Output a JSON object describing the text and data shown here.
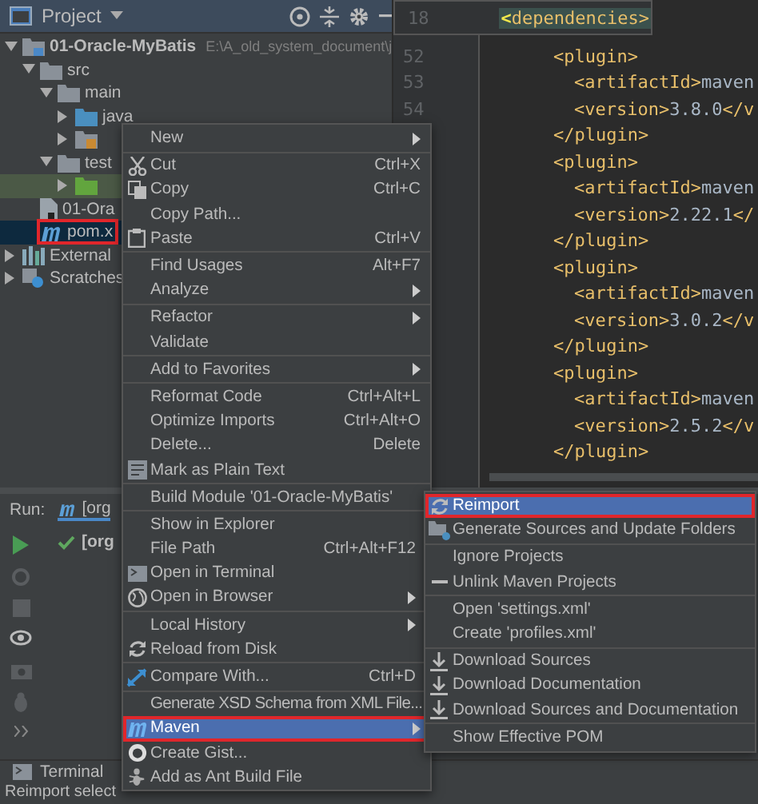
{
  "project_panel": {
    "title": "Project",
    "tree": [
      {
        "label": "01-Oracle-MyBatis",
        "path": "E:\\A_old_system_document\\j",
        "kind": "module",
        "expanded": true,
        "selected": false,
        "highlighted": false,
        "marked": false,
        "children": [
          {
            "label": "src",
            "kind": "folder",
            "expanded": true,
            "selected": false,
            "highlighted": false,
            "marked": false,
            "children": [
              {
                "label": "main",
                "kind": "folder",
                "expanded": true,
                "selected": false,
                "highlighted": false,
                "marked": false,
                "children": [
                  {
                    "label": "java",
                    "kind": "source_folder",
                    "expanded": false,
                    "selected": false,
                    "highlighted": false,
                    "marked": false
                  },
                  {
                    "kind": "resource_folder",
                    "expanded": false,
                    "selected": false,
                    "highlighted": false,
                    "marked": false
                  }
                ]
              },
              {
                "label": "test",
                "kind": "folder",
                "expanded": true,
                "selected": false,
                "highlighted": false,
                "marked": false,
                "children": [
                  {
                    "kind": "test_folder",
                    "expanded": false,
                    "selected": false,
                    "highlighted": true,
                    "marked": false
                  }
                ]
              }
            ]
          },
          {
            "label": "01-Ora",
            "kind": "module_file",
            "selected": false,
            "highlighted": false,
            "marked": false
          },
          {
            "label": "pom.x",
            "kind": "pom",
            "selected": true,
            "highlighted": false,
            "marked": true
          }
        ]
      },
      {
        "label": "External",
        "kind": "libraries",
        "expanded": false,
        "selected": false,
        "highlighted": false,
        "marked": false
      },
      {
        "label": "Scratches",
        "kind": "scratches",
        "expanded": false,
        "selected": false,
        "highlighted": false,
        "marked": false
      }
    ]
  },
  "editor": {
    "sticky_header": {
      "line": "18",
      "open": "<",
      "text": "dependencies>"
    },
    "lines": [
      {
        "number": "52",
        "kind": "outer",
        "open": "<plugin>"
      },
      {
        "number": "53",
        "kind": "inner",
        "open": "<artifactId>",
        "text": "maven"
      },
      {
        "number": "54",
        "kind": "inner",
        "open": "<version>",
        "text": "3.8.0",
        "close": "</v"
      },
      {
        "kind": "outer",
        "open": "</plugin>"
      },
      {
        "kind": "outer",
        "open": "<plugin>"
      },
      {
        "kind": "inner",
        "open": "<artifactId>",
        "text": "maven"
      },
      {
        "kind": "inner",
        "open": "<version>",
        "text": "2.22.1",
        "close": "</"
      },
      {
        "kind": "outer",
        "open": "</plugin>"
      },
      {
        "kind": "outer",
        "open": "<plugin>"
      },
      {
        "kind": "inner",
        "open": "<artifactId>",
        "text": "maven"
      },
      {
        "kind": "inner",
        "open": "<version>",
        "text": "3.0.2",
        "close": "</v"
      },
      {
        "kind": "outer",
        "open": "</plugin>"
      },
      {
        "kind": "outer",
        "open": "<plugin>"
      },
      {
        "kind": "inner",
        "open": "<artifactId>",
        "text": "maven"
      },
      {
        "kind": "inner",
        "open": "<version>",
        "text": "2.5.2",
        "close": "</v"
      },
      {
        "kind": "outer",
        "open": "</plugin>"
      }
    ]
  },
  "run_panel": {
    "label": "Run:",
    "tab": "[org",
    "tree": [
      {
        "label": "[org",
        "passed": true
      }
    ]
  },
  "status_bar": {
    "tool_tab": "Terminal",
    "message": "Reimport select"
  },
  "context_menu": [
    {
      "kind": "item",
      "label": "New",
      "submenu": true,
      "selected": false,
      "marked": false
    },
    {
      "kind": "separator"
    },
    {
      "kind": "item",
      "label": "Cut",
      "shortcut": "Ctrl+X",
      "submenu": false,
      "selected": false,
      "marked": false
    },
    {
      "kind": "item",
      "label": "Copy",
      "shortcut": "Ctrl+C",
      "submenu": false,
      "selected": false,
      "marked": false
    },
    {
      "kind": "item",
      "label": "Copy Path...",
      "submenu": false,
      "selected": false,
      "marked": false
    },
    {
      "kind": "item",
      "label": "Paste",
      "shortcut": "Ctrl+V",
      "submenu": false,
      "selected": false,
      "marked": false
    },
    {
      "kind": "separator"
    },
    {
      "kind": "item",
      "label": "Find Usages",
      "shortcut": "Alt+F7",
      "submenu": false,
      "selected": false,
      "marked": false
    },
    {
      "kind": "item",
      "label": "Analyze",
      "submenu": true,
      "selected": false,
      "marked": false
    },
    {
      "kind": "separator"
    },
    {
      "kind": "item",
      "label": "Refactor",
      "submenu": true,
      "selected": false,
      "marked": false
    },
    {
      "kind": "item",
      "label": "Validate",
      "submenu": false,
      "selected": false,
      "marked": false
    },
    {
      "kind": "separator"
    },
    {
      "kind": "item",
      "label": "Add to Favorites",
      "submenu": true,
      "selected": false,
      "marked": false
    },
    {
      "kind": "separator"
    },
    {
      "kind": "item",
      "label": "Reformat Code",
      "shortcut": "Ctrl+Alt+L",
      "submenu": false,
      "selected": false,
      "marked": false
    },
    {
      "kind": "item",
      "label": "Optimize Imports",
      "shortcut": "Ctrl+Alt+O",
      "submenu": false,
      "selected": false,
      "marked": false
    },
    {
      "kind": "item",
      "label": "Delete...",
      "shortcut": "Delete",
      "submenu": false,
      "selected": false,
      "marked": false
    },
    {
      "kind": "item",
      "label": "Mark as Plain Text",
      "submenu": false,
      "selected": false,
      "marked": false
    },
    {
      "kind": "separator"
    },
    {
      "kind": "item",
      "label": "Build Module '01-Oracle-MyBatis'",
      "submenu": false,
      "selected": false,
      "marked": false
    },
    {
      "kind": "separator"
    },
    {
      "kind": "item",
      "label": "Show in Explorer",
      "submenu": false,
      "selected": false,
      "marked": false
    },
    {
      "kind": "item",
      "label": "File Path",
      "shortcut": "Ctrl+Alt+F12",
      "submenu": false,
      "selected": false,
      "marked": false
    },
    {
      "kind": "item",
      "label": "Open in Terminal",
      "submenu": false,
      "selected": false,
      "marked": false
    },
    {
      "kind": "item",
      "label": "Open in Browser",
      "submenu": true,
      "selected": false,
      "marked": false
    },
    {
      "kind": "separator"
    },
    {
      "kind": "item",
      "label": "Local History",
      "submenu": true,
      "selected": false,
      "marked": false
    },
    {
      "kind": "item",
      "label": "Reload from Disk",
      "submenu": false,
      "selected": false,
      "marked": false
    },
    {
      "kind": "separator"
    },
    {
      "kind": "item",
      "label": "Compare With...",
      "shortcut": "Ctrl+D",
      "submenu": false,
      "selected": false,
      "marked": false
    },
    {
      "kind": "separator"
    },
    {
      "kind": "item",
      "label": "Generate XSD Schema from XML File...",
      "submenu": false,
      "selected": false,
      "marked": false
    },
    {
      "kind": "item",
      "label": "Maven",
      "submenu": true,
      "selected": true,
      "marked": true
    },
    {
      "kind": "item",
      "label": "Create Gist...",
      "submenu": false,
      "selected": false,
      "marked": false
    },
    {
      "kind": "item",
      "label": "Add as Ant Build File",
      "submenu": false,
      "selected": false,
      "marked": false
    }
  ],
  "maven_submenu": [
    {
      "kind": "item",
      "label": "Reimport",
      "selected": true,
      "marked": true
    },
    {
      "kind": "item",
      "label": "Generate Sources and Update Folders",
      "selected": false,
      "marked": false
    },
    {
      "kind": "separator"
    },
    {
      "kind": "item",
      "label": "Ignore Projects",
      "selected": false,
      "marked": false
    },
    {
      "kind": "item",
      "label": "Unlink Maven Projects",
      "selected": false,
      "marked": false
    },
    {
      "kind": "separator"
    },
    {
      "kind": "item",
      "label": "Open 'settings.xml'",
      "selected": false,
      "marked": false
    },
    {
      "kind": "item",
      "label": "Create 'profiles.xml'",
      "selected": false,
      "marked": false
    },
    {
      "kind": "separator"
    },
    {
      "kind": "item",
      "label": "Download Sources",
      "selected": false,
      "marked": false
    },
    {
      "kind": "item",
      "label": "Download Documentation",
      "selected": false,
      "marked": false
    },
    {
      "kind": "item",
      "label": "Download Sources and Documentation",
      "selected": false,
      "marked": false
    },
    {
      "kind": "separator"
    },
    {
      "kind": "item",
      "label": "Show Effective POM",
      "selected": false,
      "marked": false
    }
  ]
}
